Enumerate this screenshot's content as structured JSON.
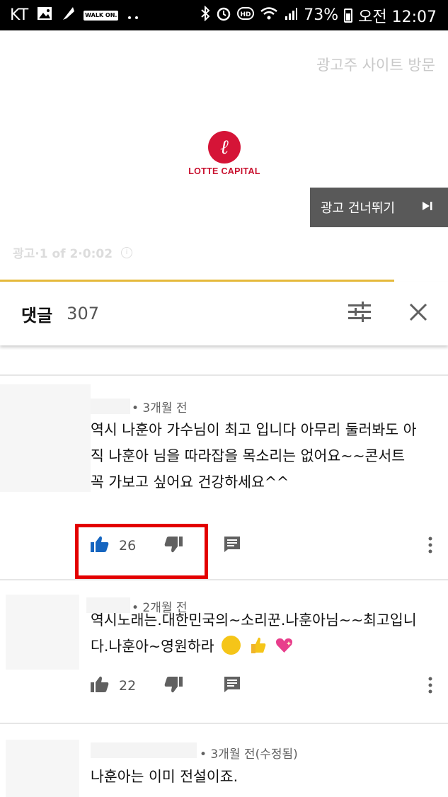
{
  "status_bar": {
    "carrier": "KT",
    "battery": "73%",
    "time": "오전 12:07",
    "walk_label": "WALK ON."
  },
  "ad": {
    "visit_link": "광고주 사이트 방문",
    "brand": "LOTTE CAPITAL",
    "skip_label": "광고 건너뛰기",
    "counter": "광고·1 of 2·0:02",
    "progress": 0.88,
    "brand_color": "#d51437"
  },
  "comments_header": {
    "title": "댓글",
    "count": "307"
  },
  "comments": [
    {
      "time": "• 3개월 전",
      "text": "역시 나훈아 가수님이  최고 입니다 아무리 둘러봐도   아직 나훈아 님을 따라잡을 목소리는 없어요~~콘서트 꼭 가보고 싶어요 건강하세요^^",
      "likes": "26",
      "liked": true
    },
    {
      "time": "• 2개월 전",
      "text": "역시노래는.대한민국의~소리꾼.나훈아님~~최고입니다.나훈아~영원하라",
      "likes": "22",
      "liked": false
    },
    {
      "time": "• 3개월 전(수정됨)",
      "text": "나훈아는 이미 전설이죠.",
      "likes": "",
      "liked": false
    }
  ],
  "colors": {
    "like_active": "#1565c0",
    "highlight": "#e30000",
    "progress": "#e5b93a"
  }
}
